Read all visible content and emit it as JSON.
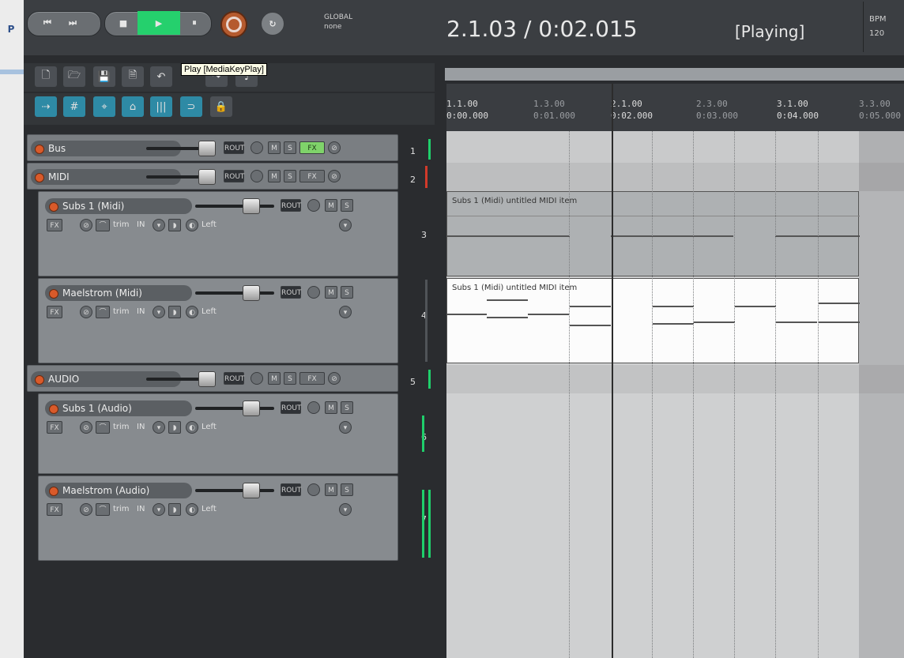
{
  "window": {
    "left_letter": "P"
  },
  "transport": {
    "loop_label_top": "GLOBAL",
    "loop_label_bottom": "none",
    "timecode": "2.1.03 / 0:02.015",
    "status": "[Playing]",
    "bpm_label": "BPM",
    "bpm_value": "120",
    "buttons": {
      "prev": "⏮",
      "next": "⏭",
      "stop": "■",
      "play": "▶",
      "pause": "⏸",
      "loop": "↻"
    }
  },
  "tooltip": "Play [MediaKeyPlay]",
  "ruler": {
    "markers": [
      {
        "bar": "1.1.00",
        "time": "0:00.000",
        "dim": false
      },
      {
        "bar": "1.3.00",
        "time": "0:01.000",
        "dim": true
      },
      {
        "bar": "2.1.00",
        "time": "0:02.000",
        "dim": false
      },
      {
        "bar": "2.3.00",
        "time": "0:03.000",
        "dim": true
      },
      {
        "bar": "3.1.00",
        "time": "0:04.000",
        "dim": false
      },
      {
        "bar": "3.3.00",
        "time": "0:05.000",
        "dim": true
      }
    ]
  },
  "tracks": [
    {
      "num": "1",
      "name": "Bus",
      "type": "folder"
    },
    {
      "num": "2",
      "name": "MIDI",
      "type": "folder"
    },
    {
      "num": "3",
      "name": "Subs 1 (Midi)",
      "type": "child"
    },
    {
      "num": "4",
      "name": "Maelstrom (Midi)",
      "type": "child"
    },
    {
      "num": "5",
      "name": "AUDIO",
      "type": "folder"
    },
    {
      "num": "6",
      "name": "Subs 1 (Audio)",
      "type": "child"
    },
    {
      "num": "7",
      "name": "Maelstrom (Audio)",
      "type": "child"
    }
  ],
  "track_controls": {
    "route": "ROUT",
    "mute": "M",
    "solo": "S",
    "fx": "FX",
    "trim": "trim",
    "input": "IN",
    "pan": "Left"
  },
  "items": [
    {
      "label": "Subs 1 (Midi) untitled MIDI item"
    },
    {
      "label": "Subs 1 (Midi) untitled MIDI item"
    }
  ]
}
